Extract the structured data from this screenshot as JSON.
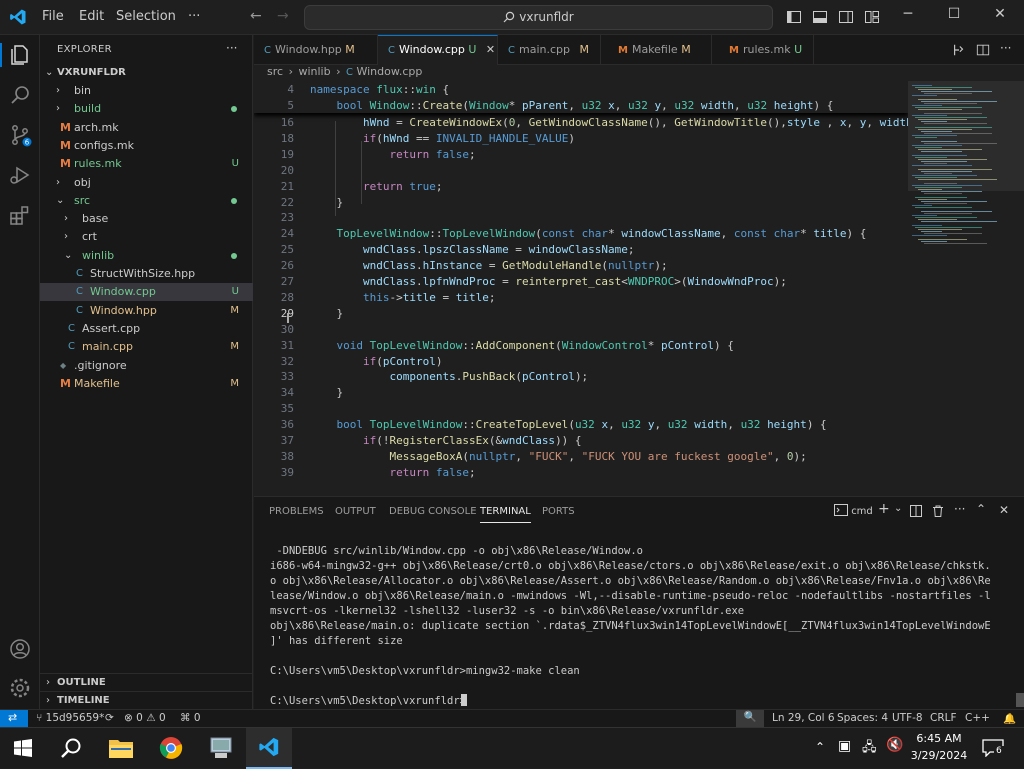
{
  "titlebar": {
    "menu": [
      "File",
      "Edit",
      "Selection",
      "···"
    ],
    "search": "vxrunfldr"
  },
  "explorer": {
    "header": "EXPLORER",
    "more": "···",
    "root": "VXRUNFLDR",
    "tree": [
      {
        "label": "bin",
        "indent": 1,
        "kind": "folder",
        "open": false,
        "status": ""
      },
      {
        "label": "build",
        "indent": 1,
        "kind": "folder",
        "open": false,
        "status": "dot",
        "color": "u"
      },
      {
        "label": "arch.mk",
        "indent": 1,
        "kind": "make",
        "status": ""
      },
      {
        "label": "configs.mk",
        "indent": 1,
        "kind": "make",
        "status": ""
      },
      {
        "label": "rules.mk",
        "indent": 1,
        "kind": "make",
        "status": "U",
        "color": "u"
      },
      {
        "label": "obj",
        "indent": 1,
        "kind": "folder",
        "open": false,
        "status": ""
      },
      {
        "label": "src",
        "indent": 1,
        "kind": "folder",
        "open": true,
        "status": "dot",
        "color": "u"
      },
      {
        "label": "base",
        "indent": 2,
        "kind": "folder",
        "open": false,
        "status": ""
      },
      {
        "label": "crt",
        "indent": 2,
        "kind": "folder",
        "open": false,
        "status": ""
      },
      {
        "label": "winlib",
        "indent": 2,
        "kind": "folder",
        "open": true,
        "status": "dot",
        "color": "u"
      },
      {
        "label": "StructWithSize.hpp",
        "indent": 3,
        "kind": "cpp",
        "status": ""
      },
      {
        "label": "Window.cpp",
        "indent": 3,
        "kind": "cpp",
        "status": "U",
        "color": "u",
        "selected": true
      },
      {
        "label": "Window.hpp",
        "indent": 3,
        "kind": "cpp",
        "status": "M",
        "color": "m"
      },
      {
        "label": "Assert.cpp",
        "indent": 2,
        "kind": "cpp",
        "status": ""
      },
      {
        "label": "main.cpp",
        "indent": 2,
        "kind": "cpp",
        "status": "M",
        "color": "m"
      },
      {
        "label": ".gitignore",
        "indent": 1,
        "kind": "git",
        "status": ""
      },
      {
        "label": "Makefile",
        "indent": 1,
        "kind": "make",
        "status": "M",
        "color": "m"
      }
    ],
    "outline": "OUTLINE",
    "timeline": "TIMELINE"
  },
  "tabs": [
    {
      "label": "Window.hpp",
      "status": "M",
      "icon": "C",
      "active": false
    },
    {
      "label": "Window.cpp",
      "status": "U",
      "icon": "C",
      "active": true
    },
    {
      "label": "main.cpp",
      "status": "M",
      "icon": "C",
      "active": false
    },
    {
      "label": "Makefile",
      "status": "M",
      "icon": "M",
      "active": false
    },
    {
      "label": "rules.mk",
      "status": "U",
      "icon": "M",
      "active": false
    }
  ],
  "breadcrumb": [
    "src",
    "winlib",
    "Window.cpp"
  ],
  "editor": {
    "lines": [
      {
        "n": "4",
        "t": "namespace flux::win {"
      },
      {
        "n": "5",
        "t": "    bool Window::Create(Window* pParent, u32 x, u32 y, u32 width, u32 height) {"
      },
      {
        "n": "16",
        "t": "        hWnd = CreateWindowEx(0, GetWindowClassName(), GetWindowTitle(),style , x, y, width, h"
      },
      {
        "n": "18",
        "t": "        if(hWnd == INVALID_HANDLE_VALUE)"
      },
      {
        "n": "19",
        "t": "            return false;"
      },
      {
        "n": "20",
        "t": ""
      },
      {
        "n": "21",
        "t": "        return true;"
      },
      {
        "n": "22",
        "t": "    }"
      },
      {
        "n": "23",
        "t": ""
      },
      {
        "n": "24",
        "t": "    TopLevelWindow::TopLevelWindow(const char* windowClassName, const char* title) {"
      },
      {
        "n": "25",
        "t": "        wndClass.lpszClassName = windowClassName;"
      },
      {
        "n": "26",
        "t": "        wndClass.hInstance = GetModuleHandle(nullptr);"
      },
      {
        "n": "27",
        "t": "        wndClass.lpfnWndProc = reinterpret_cast<WNDPROC>(WindowWndProc);"
      },
      {
        "n": "28",
        "t": "        this->title = title;"
      },
      {
        "n": "29",
        "t": "    }"
      },
      {
        "n": "30",
        "t": ""
      },
      {
        "n": "31",
        "t": "    void TopLevelWindow::AddComponent(WindowControl* pControl) {"
      },
      {
        "n": "32",
        "t": "        if(pControl)"
      },
      {
        "n": "33",
        "t": "            components.PushBack(pControl);"
      },
      {
        "n": "34",
        "t": "    }"
      },
      {
        "n": "35",
        "t": ""
      },
      {
        "n": "36",
        "t": "    bool TopLevelWindow::CreateTopLevel(u32 x, u32 y, u32 width, u32 height) {"
      },
      {
        "n": "37",
        "t": "        if(!RegisterClassEx(&wndClass)) {"
      },
      {
        "n": "38",
        "t": "            MessageBoxA(nullptr, \"FUCK\", \"FUCK YOU are fuckest google\", 0);"
      },
      {
        "n": "39",
        "t": "            return false;"
      }
    ]
  },
  "panel": {
    "tabs": [
      "PROBLEMS",
      "OUTPUT",
      "DEBUG CONSOLE",
      "TERMINAL",
      "PORTS"
    ],
    "active_tab": "TERMINAL",
    "shell": "cmd",
    "lines": [
      " -DNDEBUG src/winlib/Window.cpp -o obj\\x86\\Release/Window.o",
      "i686-w64-mingw32-g++ obj\\x86\\Release/crt0.o obj\\x86\\Release/ctors.o obj\\x86\\Release/exit.o obj\\x86\\Release/chkstk.",
      "o obj\\x86\\Release/Allocator.o obj\\x86\\Release/Assert.o obj\\x86\\Release/Random.o obj\\x86\\Release/Fnv1a.o obj\\x86\\Re",
      "lease/Window.o obj\\x86\\Release/main.o -mwindows -Wl,--disable-runtime-pseudo-reloc -nodefaultlibs -nostartfiles -l",
      "msvcrt-os -lkernel32 -lshell32 -luser32 -s -o bin\\x86\\Release/vxrunfldr.exe",
      "obj\\x86\\Release/main.o: duplicate section `.rdata$_ZTVN4flux3win14TopLevelWindowE[__ZTVN4flux3win14TopLevelWindowE",
      "]' has different size",
      "",
      "C:\\Users\\vm5\\Desktop\\vxrunfldr>mingw32-make clean",
      "",
      "C:\\Users\\vm5\\Desktop\\vxrunfldr>"
    ]
  },
  "statusbar": {
    "branch": "15d95659*",
    "errors": "0",
    "warnings": "0",
    "ports": "0",
    "position": "Ln 29, Col 6",
    "spaces": "Spaces: 4",
    "encoding": "UTF-8",
    "eol": "CRLF",
    "language": "C++"
  },
  "taskbar": {
    "time": "6:45 AM",
    "date": "3/29/2024",
    "notifications": "6"
  },
  "colors": {
    "accent": "#0078d4",
    "modified": "#e2c08d",
    "untracked": "#73c991",
    "keyword": "#569cd6",
    "type": "#4ec9b0",
    "function": "#dcdcaa",
    "control": "#c586c0",
    "string": "#ce9178",
    "number": "#b5cea8"
  }
}
